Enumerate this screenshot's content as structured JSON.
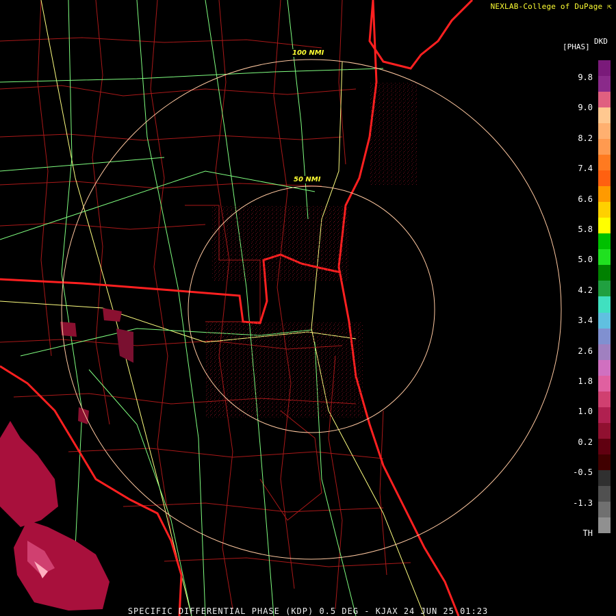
{
  "branding": "NEXLAB-College of DuPage",
  "brand_icon": "arrow-corner-icon",
  "product_code": "DKD",
  "unit_label": "[PHAS]",
  "title": "SPECIFIC DIFFERENTIAL PHASE (KDP) 0.5 DEG - KJAX 24 JUN 25 01:23",
  "range_rings": [
    {
      "label": "50 NMI",
      "range_nmi": 50
    },
    {
      "label": "100 NMI",
      "range_nmi": 100
    }
  ],
  "colorbar": {
    "ticks": [
      "9.8",
      "9.0",
      "8.2",
      "7.4",
      "6.6",
      "5.8",
      "5.0",
      "4.2",
      "3.4",
      "2.6",
      "1.8",
      "1.0",
      "0.2",
      "-0.5",
      "-1.3",
      "TH"
    ],
    "colors": [
      "#7a1a7a",
      "#8a2a8a",
      "#e06080",
      "#ffc890",
      "#ffb070",
      "#ff9a50",
      "#ff7a20",
      "#ff6010",
      "#ff9a00",
      "#ffd000",
      "#ffff00",
      "#00c000",
      "#20e020",
      "#008000",
      "#20a040",
      "#40e0c0",
      "#60c0e0",
      "#8090d0",
      "#a080c0",
      "#d070c0",
      "#e060a0",
      "#d04070",
      "#b02050",
      "#901030",
      "#600010",
      "#400000",
      "#303030",
      "#505050",
      "#707070",
      "#909090",
      "#000000"
    ],
    "accent": "#ffff33"
  },
  "colors": {
    "boundary_county": "#c81e1e",
    "boundary_state": "#ff2020",
    "highway_major": "#ffff80",
    "highway_minor": "#80ff80",
    "ring": "#ffc8a0",
    "radar_echo": "#b0143c"
  }
}
